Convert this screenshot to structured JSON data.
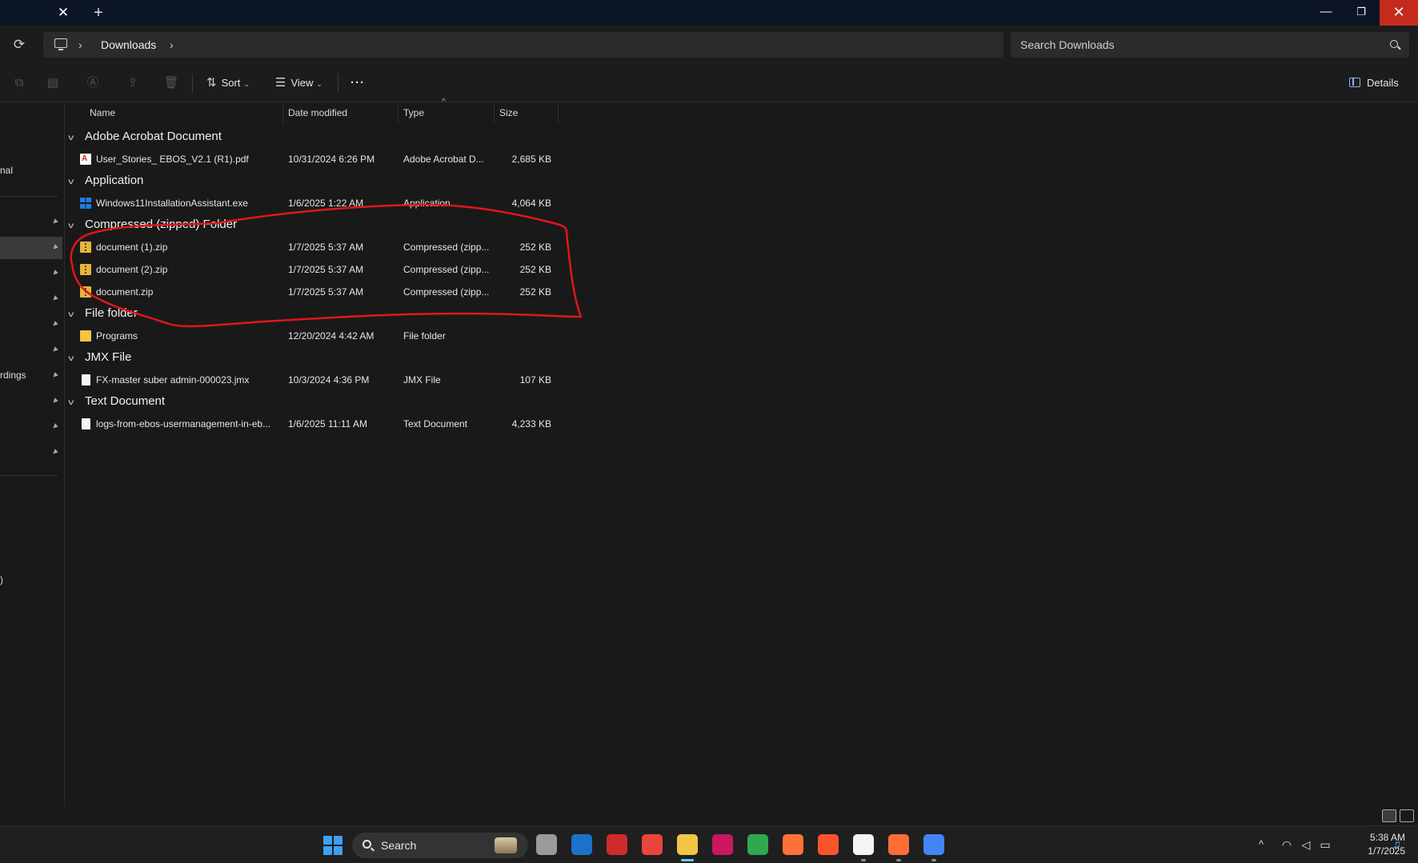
{
  "window": {
    "close_glyph": "✕",
    "new_tab_glyph": "+",
    "minimize_glyph": "—",
    "maximize_glyph": "❐",
    "close_window_glyph": "✕"
  },
  "address": {
    "refresh_glyph": "⟳",
    "breadcrumb": [
      "Downloads"
    ],
    "separator_glyph": "›",
    "search_placeholder": "Search Downloads"
  },
  "toolbar": {
    "sort_label": "Sort",
    "view_label": "View",
    "more_label": "···",
    "details_label": "Details",
    "sort_glyph": "⇅",
    "view_glyph": "☰",
    "chevron_glyph": "⌄"
  },
  "nav": {
    "items": [
      {
        "label": "nal"
      },
      {
        "label": "rdings"
      },
      {
        "label": ")"
      }
    ],
    "pin_glyph": "📌"
  },
  "columns": {
    "name": "Name",
    "date": "Date modified",
    "type": "Type",
    "size": "Size",
    "sort_caret": "^"
  },
  "groups": [
    {
      "title": "Adobe Acrobat Document",
      "files": [
        {
          "name": "User_Stories_ EBOS_V2.1 (R1).pdf",
          "date": "10/31/2024 6:26 PM",
          "type": "Adobe Acrobat D...",
          "size": "2,685 KB",
          "icon": "pdf-icon"
        }
      ]
    },
    {
      "title": "Application",
      "files": [
        {
          "name": "Windows11InstallationAssistant.exe",
          "date": "1/6/2025 1:22 AM",
          "type": "Application",
          "size": "4,064 KB",
          "icon": "windows-app-icon"
        }
      ]
    },
    {
      "title": "Compressed (zipped) Folder",
      "files": [
        {
          "name": "document (1).zip",
          "date": "1/7/2025 5:37 AM",
          "type": "Compressed (zipp...",
          "size": "252 KB",
          "icon": "zip-folder-icon"
        },
        {
          "name": "document (2).zip",
          "date": "1/7/2025 5:37 AM",
          "type": "Compressed (zipp...",
          "size": "252 KB",
          "icon": "zip-folder-icon"
        },
        {
          "name": "document.zip",
          "date": "1/7/2025 5:37 AM",
          "type": "Compressed (zipp...",
          "size": "252 KB",
          "icon": "zip-folder-icon"
        }
      ]
    },
    {
      "title": "File folder",
      "files": [
        {
          "name": "Programs",
          "date": "12/20/2024 4:42 AM",
          "type": "File folder",
          "size": "",
          "icon": "folder-icon"
        }
      ]
    },
    {
      "title": "JMX File",
      "files": [
        {
          "name": "FX-master suber admin-000023.jmx",
          "date": "10/3/2024 4:36 PM",
          "type": "JMX File",
          "size": "107 KB",
          "icon": "file-icon"
        }
      ]
    },
    {
      "title": "Text Document",
      "files": [
        {
          "name": "logs-from-ebos-usermanagement-in-eb...",
          "date": "1/6/2025 11:11 AM",
          "type": "Text Document",
          "size": "4,233 KB",
          "icon": "text-file-icon"
        }
      ]
    }
  ],
  "taskbar": {
    "search_label": "Search",
    "chevron_glyph": "^",
    "time": "5:38 AM",
    "date": "1/7/2025",
    "apps": [
      {
        "name": "task-view-icon",
        "color": "#9a9a9a"
      },
      {
        "name": "outlook-icon",
        "color": "#1a73c9"
      },
      {
        "name": "recorder-icon",
        "color": "#d12a2a"
      },
      {
        "name": "chrome-icon",
        "color": "#e8453c"
      },
      {
        "name": "file-explorer-icon",
        "color": "#f3c545"
      },
      {
        "name": "intellij-icon",
        "color": "#c9185f"
      },
      {
        "name": "chat-icon",
        "color": "#2fa84f"
      },
      {
        "name": "firefox-icon",
        "color": "#ff7139"
      },
      {
        "name": "brave-icon",
        "color": "#fb542b"
      },
      {
        "name": "headset-icon",
        "color": "#f4f4f4"
      },
      {
        "name": "postman-icon",
        "color": "#ff6c37"
      },
      {
        "name": "chrome-profile-icon",
        "color": "#4285f4"
      }
    ]
  },
  "annotation": {
    "color": "#e0161b"
  }
}
